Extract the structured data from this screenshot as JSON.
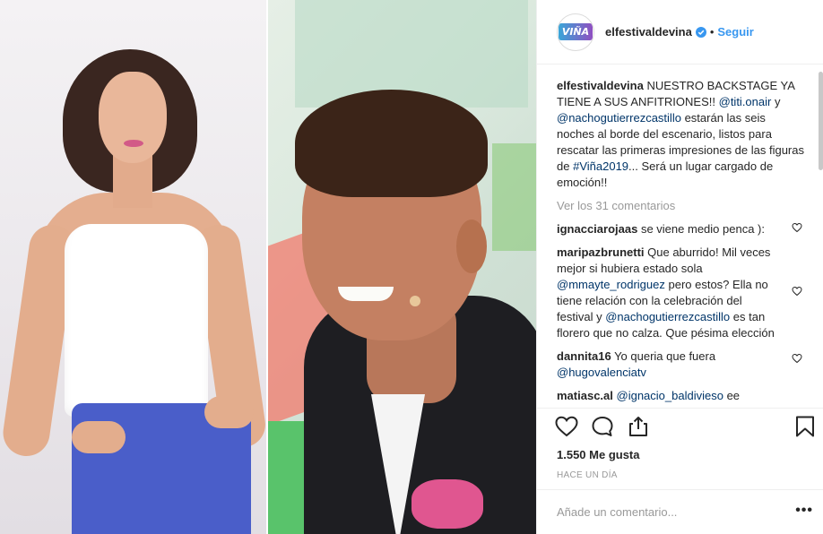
{
  "header": {
    "username": "elfestivaldevina",
    "avatar_text": "VIÑA",
    "separator": "•",
    "follow_label": "Seguir"
  },
  "caption": {
    "username": "elfestivaldevina",
    "text_1": "NUESTRO BACKSTAGE YA TIENE A SUS ANFITRIONES!!",
    "mention_1": "@titi.onair",
    "text_2": "y",
    "mention_2": "@nachogutierrezcastillo",
    "text_3": "estarán las seis noches al borde del escenario, listos para rescatar las primeras impresiones de las figuras de",
    "hashtag": "#Viña2019",
    "text_4": "... Será un lugar cargado de emoción!!"
  },
  "view_all_comments": "Ver los 31 comentarios",
  "comments": [
    {
      "username": "ignacciarojaas",
      "text": "se viene medio penca ):"
    },
    {
      "username": "maripazbrunetti",
      "text_1": "Que aburrido! Mil veces mejor si hubiera estado sola",
      "mention_1": "@mmayte_rodriguez",
      "text_2": "pero estos? Ella no tiene relación con la celebración del festival y",
      "mention_2": "@nachogutierrezcastillo",
      "text_3": "es tan florero que no calza. Que pésima elección"
    },
    {
      "username": "dannita16",
      "text": "Yo queria que fuera",
      "mention": "@hugovalenciatv"
    },
    {
      "username": "matiasc.al",
      "mention": "@ignacio_baldivieso",
      "text": "ee"
    }
  ],
  "likes": "1.550 Me gusta",
  "time": "HACE UN DÍA",
  "add_comment": {
    "placeholder": "Añade un comentario..."
  },
  "more_label": "•••",
  "colors": {
    "link": "#3897f0",
    "mention": "#003569",
    "muted": "#999999",
    "border": "#efefef"
  }
}
